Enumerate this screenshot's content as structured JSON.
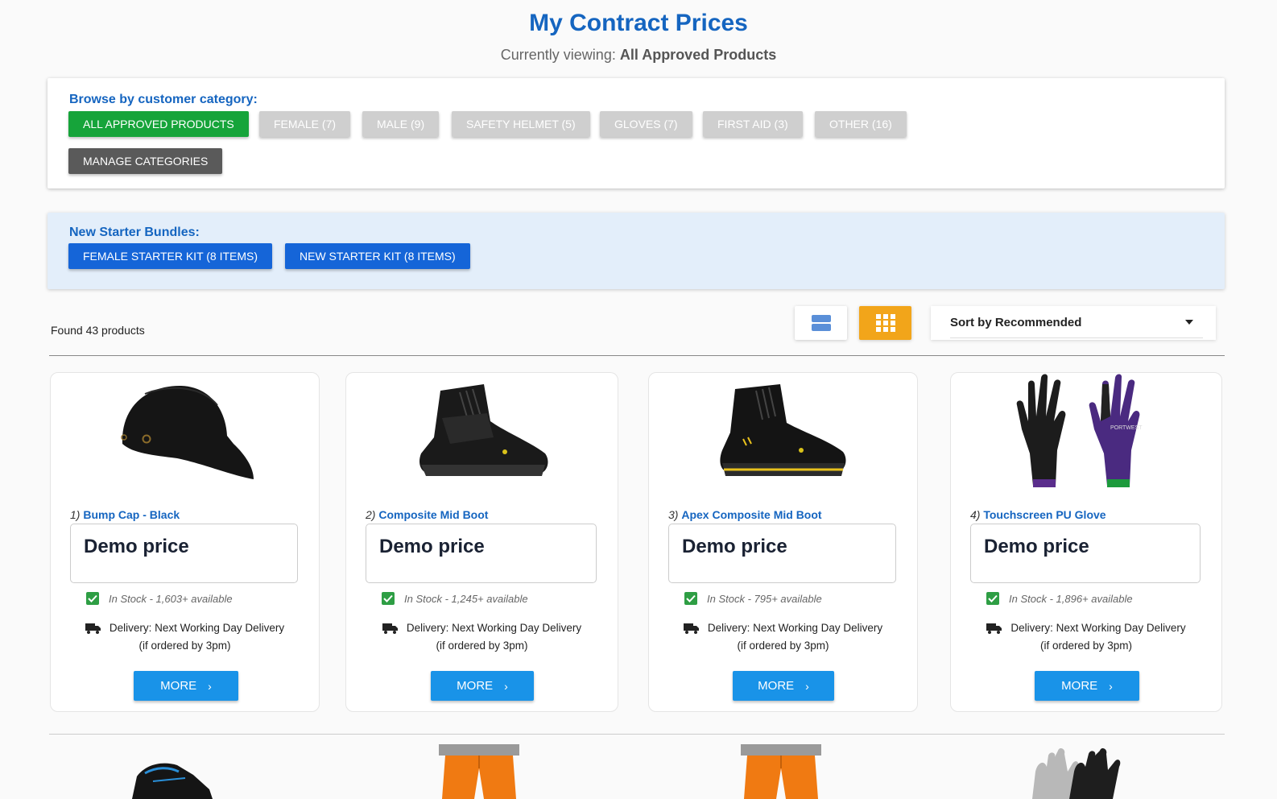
{
  "header": {
    "title": "My Contract Prices",
    "subtitle_prefix": "Currently viewing:",
    "subtitle_value": "All Approved Products"
  },
  "categories": {
    "label": "Browse by customer category:",
    "items": [
      {
        "label": "ALL APPROVED PRODUCTS",
        "active": true
      },
      {
        "label": "FEMALE (7)",
        "active": false
      },
      {
        "label": "MALE (9)",
        "active": false
      },
      {
        "label": "SAFETY HELMET (5)",
        "active": false
      },
      {
        "label": "GLOVES (7)",
        "active": false
      },
      {
        "label": "FIRST AID (3)",
        "active": false
      },
      {
        "label": "OTHER (16)",
        "active": false
      }
    ],
    "manage_label": "MANAGE CATEGORIES"
  },
  "bundles": {
    "label": "New Starter Bundles:",
    "items": [
      {
        "label": "FEMALE STARTER KIT (8 ITEMS)"
      },
      {
        "label": "NEW STARTER KIT (8 ITEMS)"
      }
    ]
  },
  "toolbar": {
    "found_text": "Found 43 products",
    "view_list_icon": "list-view-icon",
    "view_grid_icon": "grid-view-icon",
    "view_active": "grid",
    "sort_label": "Sort by Recommended"
  },
  "products": [
    {
      "num": "1)",
      "name": "Bump Cap - Black",
      "price": "Demo price",
      "stock": "In Stock - 1,603+ available",
      "delivery_line1": "Delivery: Next Working Day Delivery",
      "delivery_line2": "(if ordered by 3pm)",
      "more": "MORE",
      "image": "bump-cap-image"
    },
    {
      "num": "2)",
      "name": "Composite Mid Boot",
      "price": "Demo price",
      "stock": "In Stock - 1,245+ available",
      "delivery_line1": "Delivery: Next Working Day Delivery",
      "delivery_line2": "(if ordered by 3pm)",
      "more": "MORE",
      "image": "boot-image"
    },
    {
      "num": "3)",
      "name": "Apex Composite Mid Boot",
      "price": "Demo price",
      "stock": "In Stock - 795+ available",
      "delivery_line1": "Delivery: Next Working Day Delivery",
      "delivery_line2": "(if ordered by 3pm)",
      "more": "MORE",
      "image": "boot-image"
    },
    {
      "num": "4)",
      "name": "Touchscreen PU Glove",
      "price": "Demo price",
      "stock": "In Stock - 1,896+ available",
      "delivery_line1": "Delivery: Next Working Day Delivery",
      "delivery_line2": "(if ordered by 3pm)",
      "more": "MORE",
      "image": "glove-image"
    }
  ],
  "colors": {
    "brand_blue": "#1565c0",
    "active_green": "#16a43a",
    "grid_toggle_orange": "#f2a51a",
    "more_button": "#1993e8"
  }
}
